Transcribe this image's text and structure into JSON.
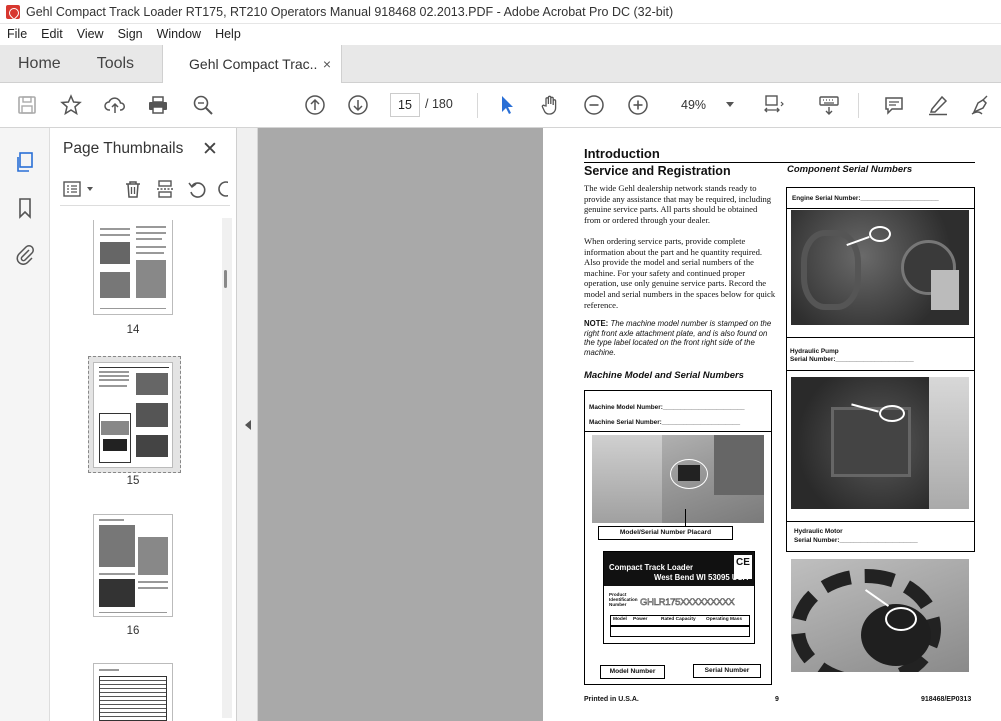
{
  "window": {
    "title": "Gehl Compact Track Loader RT175, RT210 Operators Manual 918468 02.2013.PDF - Adobe Acrobat Pro DC (32-bit)"
  },
  "menu": [
    "File",
    "Edit",
    "View",
    "Sign",
    "Window",
    "Help"
  ],
  "tabs": {
    "home": "Home",
    "tools": "Tools",
    "document": "Gehl Compact Trac...",
    "close": "×"
  },
  "toolbar": {
    "current_page": "15",
    "total_pages": "/ 180",
    "zoom": "49%"
  },
  "thumbnails": {
    "title": "Page Thumbnails",
    "close": "✕",
    "pages": [
      "14",
      "15",
      "16"
    ],
    "selected": "15"
  },
  "page": {
    "heading": "Introduction",
    "section": "Service and Registration",
    "para1": "The wide Gehl dealership network stands ready to provide any assistance that may be required, including genuine service parts. All parts should be obtained from or ordered through your dealer.",
    "para2": "When ordering service parts, provide complete information about the part and he quantity required. Also provide the model and serial numbers of the machine. For your safety and continued proper operation, use only genuine service parts. Record the model and serial numbers in the spaces below for quick reference.",
    "note_label": "NOTE:",
    "note_text": "The machine model number is stamped on the right front axle attachment plate, and is also found on the type label located on the front right side of the machine.",
    "machine_heading": "Machine Model and Serial Numbers",
    "machine_model_field": "Machine Model Number:_______________________",
    "machine_serial_field": "Machine Serial Number:______________________",
    "placard_callout": "Model/Serial Number Placard",
    "plate_line1": "Compact Track Loader",
    "plate_line2": "West Bend WI 53095 USA",
    "plate_ce": "CE",
    "plate_product_id": "Product Identification Number",
    "plate_serial_example": "GHLR175XXXXXXXXX",
    "plate_cells": [
      "Model",
      "Power",
      "Rated Capacity",
      "Operating Mass"
    ],
    "model_number_callout": "Model Number",
    "serial_number_callout": "Serial Number",
    "component_heading": "Component Serial Numbers",
    "engine_field": "Engine Serial Number:______________________",
    "pump_label": "Hydraulic Pump",
    "pump_field": "Serial Number:______________________",
    "motor_label": "Hydraulic Motor",
    "motor_field": "Serial Number:______________________",
    "footer_left": "Printed in U.S.A.",
    "footer_center": "9",
    "footer_right": "918468/EP0313"
  }
}
